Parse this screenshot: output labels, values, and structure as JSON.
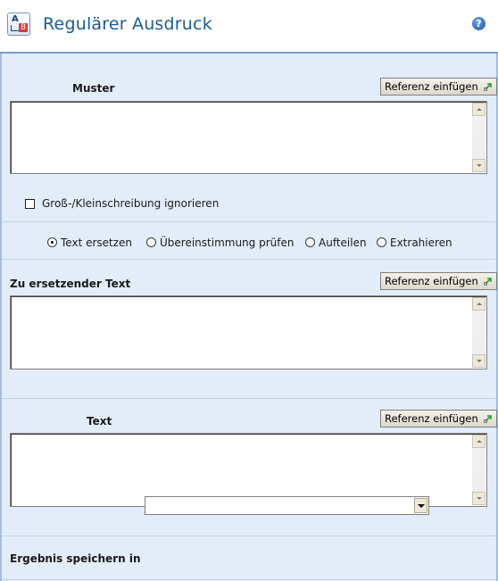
{
  "header": {
    "title": "Regulärer Ausdruck",
    "help_symbol": "?"
  },
  "pattern": {
    "label": "Muster",
    "insert_ref_label": "Referenz einfügen",
    "value": ""
  },
  "ignore_case": {
    "label": "Groß-/Kleinschreibung ignorieren",
    "checked": false
  },
  "mode": {
    "options": [
      {
        "label": "Text ersetzen",
        "checked": true
      },
      {
        "label": "Übereinstimmung prüfen",
        "checked": false
      },
      {
        "label": "Aufteilen",
        "checked": false
      },
      {
        "label": "Extrahieren",
        "checked": false
      }
    ]
  },
  "replacement": {
    "label": "Zu ersetzender Text",
    "insert_ref_label": "Referenz einfügen",
    "value": ""
  },
  "text": {
    "label": "Text",
    "insert_ref_label": "Referenz einfügen",
    "value": ""
  },
  "result": {
    "label": "Ergebnis speichern in",
    "selected": ""
  },
  "colors": {
    "title": "#1c5b8f",
    "panel_bg": "#e3edf9",
    "panel_border": "#7c9bc6"
  }
}
